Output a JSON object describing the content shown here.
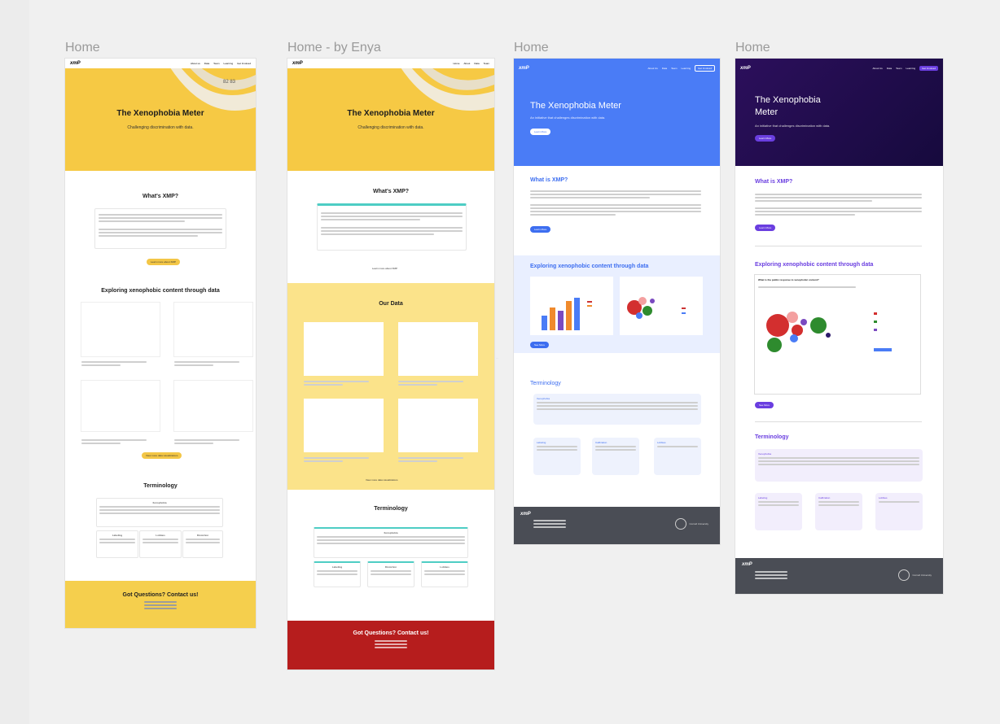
{
  "frames": [
    {
      "label": "Home",
      "nav": {
        "logo": "xmP",
        "links": [
          "About us",
          "Data",
          "Team",
          "Learning",
          "Get Involved"
        ]
      },
      "hero": {
        "title": "The Xenophobia Meter",
        "subtitle": "Challenging discrimination with data."
      },
      "about": {
        "title": "What's XMP?",
        "button": "Learn more about XMP"
      },
      "explore": {
        "title": "Exploring xenophobic content through data",
        "button": "View more data visualizations"
      },
      "terminology": {
        "title": "Terminology",
        "main_card": "Xenophobia",
        "cards": [
          "Labeling",
          "Lobbies",
          "Distortion"
        ]
      },
      "footer": {
        "title": "Got Questions? Contact us!"
      },
      "colors": {
        "hero": "#f6c944",
        "footer": "#f5cf4d",
        "button": "#f3c646"
      }
    },
    {
      "label": "Home - by Enya",
      "nav": {
        "logo": "xmP",
        "links": [
          "Home",
          "About",
          "Data",
          "Team"
        ]
      },
      "hero": {
        "title": "The Xenophobia Meter",
        "subtitle": "Challenging discrimination with data."
      },
      "about": {
        "title": "What's XMP?",
        "button": "Learn more about XMP"
      },
      "data": {
        "title": "Our Data",
        "button": "View more data visualizations"
      },
      "terminology": {
        "title": "Terminology",
        "main_card": "Xenophobia",
        "cards": [
          "Labeling",
          "Distortion",
          "Lobbies"
        ]
      },
      "footer": {
        "title": "Got Questions? Contact us!"
      },
      "colors": {
        "hero": "#f6c944",
        "data_bg": "#fbe38a",
        "footer": "#b61d1d",
        "accent": "#4ecdc4"
      }
    },
    {
      "label": "Home",
      "nav": {
        "logo": "xmP",
        "links": [
          "About Us",
          "Data",
          "Team",
          "Learning"
        ],
        "cta": "Get Involved"
      },
      "hero": {
        "title": "The Xenophobia Meter",
        "subtitle": "An initiative that challenges discrimination with data.",
        "button": "Learn More"
      },
      "about": {
        "title": "What is XMP?",
        "button": "Learn More"
      },
      "explore": {
        "title": "Exploring xenophobic content through data",
        "button": "See More"
      },
      "terminology": {
        "title": "Terminology",
        "main_card": "Xenophobia",
        "cards": [
          "Labeling",
          "Calibration",
          "Lobbies"
        ]
      },
      "footer": {
        "org": "Cornell University"
      },
      "colors": {
        "hero": "#4a7cf6",
        "explore_bg": "#e9efff",
        "footer": "#4a4d55",
        "accent": "#3d6ef0"
      }
    },
    {
      "label": "Home",
      "nav": {
        "logo": "xmP",
        "links": [
          "About Us",
          "Data",
          "Team",
          "Learning"
        ],
        "cta": "Get Involved"
      },
      "hero": {
        "title": "The Xenophobia Meter",
        "subtitle": "An initiative that challenges discrimination with data.",
        "button": "Learn More"
      },
      "about": {
        "title": "What is XMP?",
        "button": "Learn More"
      },
      "explore": {
        "title": "Exploring xenophobic content through data",
        "chart_title": "What is the public response to xenophobic content?",
        "button": "See More"
      },
      "terminology": {
        "title": "Terminology",
        "main_card": "Xenophobia",
        "cards": [
          "Labeling",
          "Calibration",
          "Lobbies"
        ]
      },
      "footer": {
        "org": "Cornell University"
      },
      "colors": {
        "hero": "#2c0f5c",
        "accent": "#6a3ee0",
        "footer": "#4a4d55",
        "card_bg": "#f2eefc"
      }
    }
  ]
}
